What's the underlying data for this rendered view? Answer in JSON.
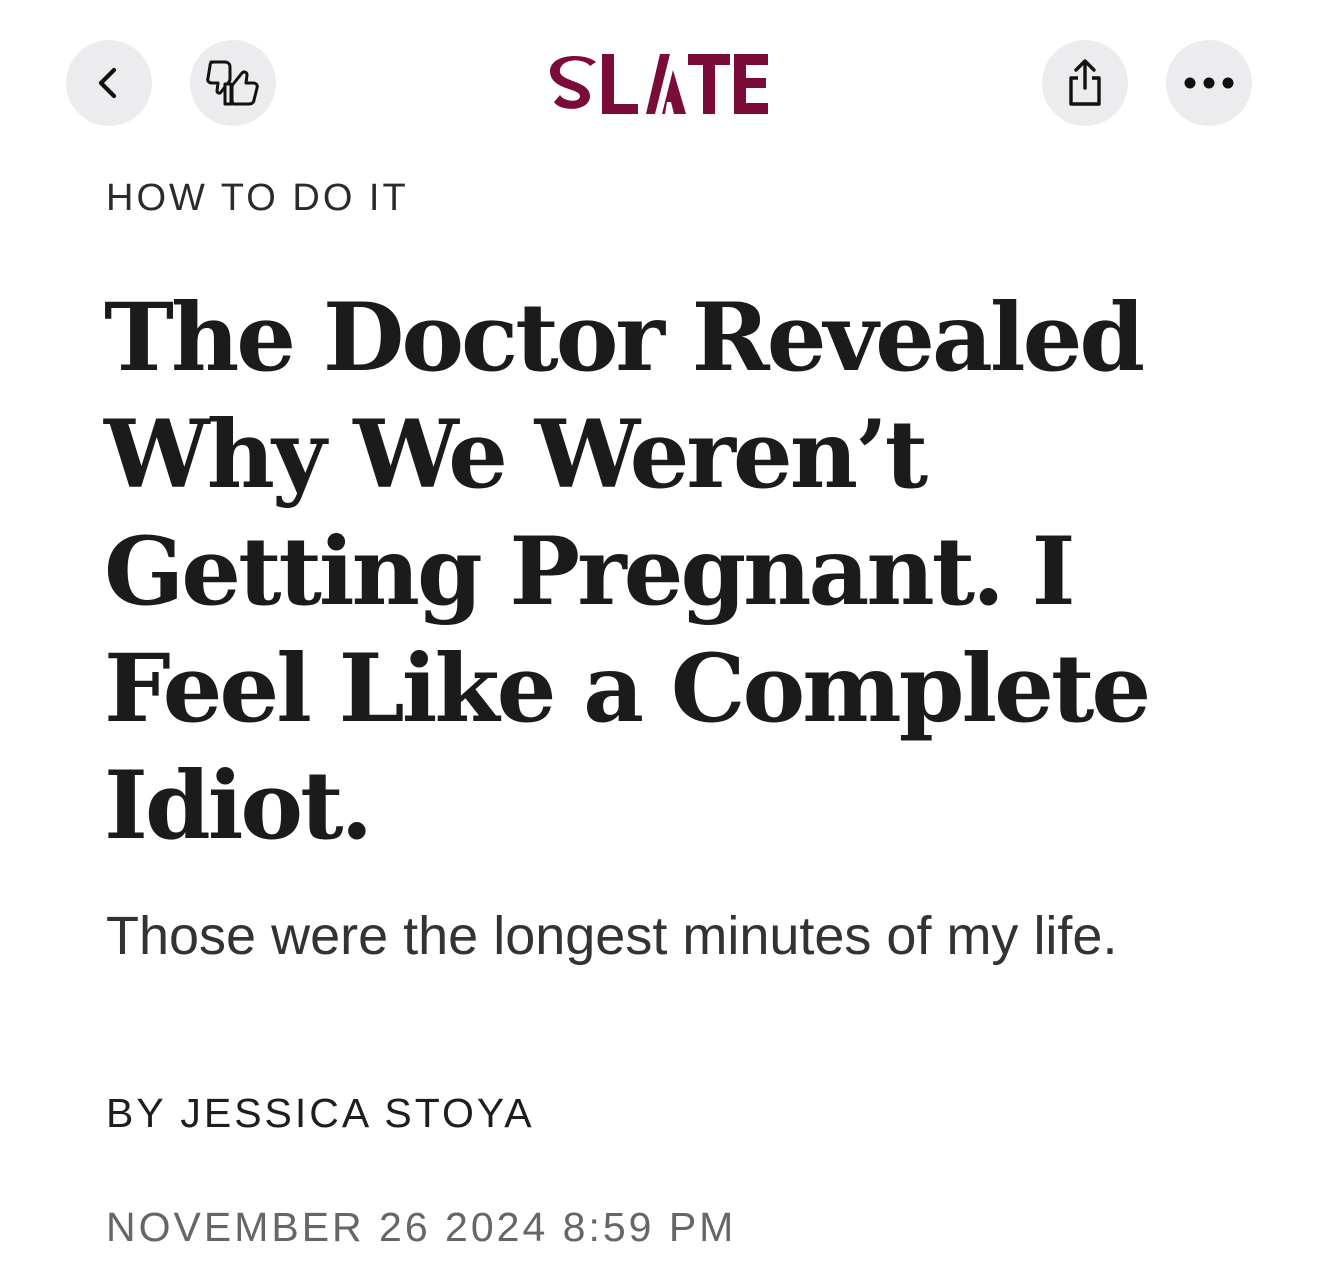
{
  "toolbar": {
    "back_icon": "chevron-left-icon",
    "feedback_icon": "thumbs-up-down-icon",
    "share_icon": "share-icon",
    "more_icon": "ellipsis-icon"
  },
  "brand": {
    "logo_text": "SLATE",
    "logo_color": "#7b0c39"
  },
  "article": {
    "kicker": "HOW TO DO IT",
    "headline": "The Doctor Revealed Why We Weren’t Getting Pregnant. I Feel Like a Complete Idiot.",
    "dek": "Those were the longest minutes of my life.",
    "byline_prefix": "BY",
    "author": "JESSICA STOYA",
    "date": "NOVEMBER 26 2024 8:59 PM"
  }
}
